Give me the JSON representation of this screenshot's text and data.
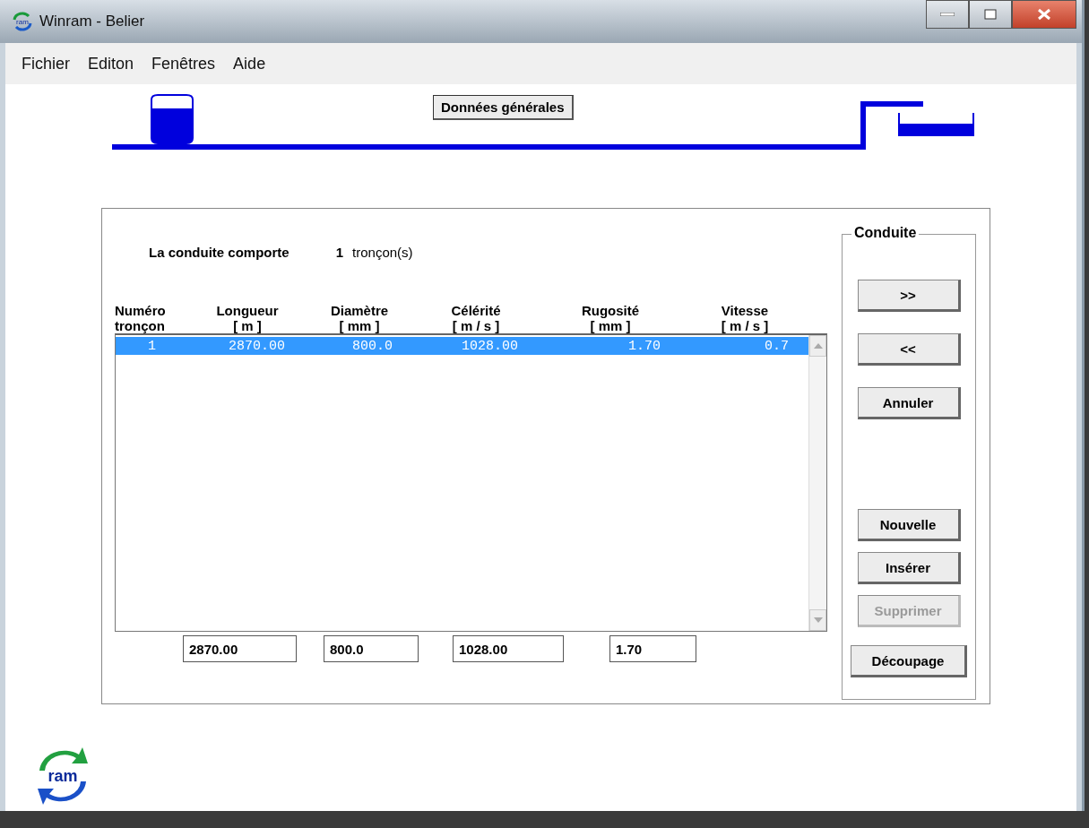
{
  "window": {
    "title": "Winram - Belier",
    "icon_text": "ram"
  },
  "menu": [
    "Fichier",
    "Editon",
    "Fenêtres",
    "Aide"
  ],
  "general_button": "Données générales",
  "summary": {
    "label": "La conduite comporte",
    "count": "1",
    "unit": "tronçon(s)"
  },
  "table": {
    "columns": [
      {
        "line1": "Numéro",
        "line2": "tronçon"
      },
      {
        "line1": "Longueur",
        "line2": "[ m ]"
      },
      {
        "line1": "Diamètre",
        "line2": "[ mm ]"
      },
      {
        "line1": "Célérité",
        "line2": "[ m / s ]"
      },
      {
        "line1": "Rugosité",
        "line2": "[ mm ]"
      },
      {
        "line1": "Vitesse",
        "line2": "[ m / s ]"
      }
    ],
    "rows": [
      {
        "cells": [
          "1",
          "2870.00",
          "800.0",
          "1028.00",
          "1.70",
          "0.7"
        ],
        "selected": true
      }
    ]
  },
  "fields": [
    "2870.00",
    "800.0",
    "1028.00",
    "1.70"
  ],
  "group": {
    "title": "Conduite",
    "buttons": [
      {
        "label": ">>",
        "disabled": false,
        "kind": "nav"
      },
      {
        "label": "<<",
        "disabled": false,
        "kind": "nav"
      },
      {
        "label": "Annuler",
        "disabled": false,
        "kind": "top"
      },
      {
        "label": "Nouvelle",
        "disabled": false,
        "kind": "bottom"
      },
      {
        "label": "Insérer",
        "disabled": false,
        "kind": "bottom"
      },
      {
        "label": "Supprimer",
        "disabled": true,
        "kind": "bottom"
      },
      {
        "label": "Découpage",
        "disabled": false,
        "kind": "last"
      }
    ]
  },
  "logo_text": "ram"
}
